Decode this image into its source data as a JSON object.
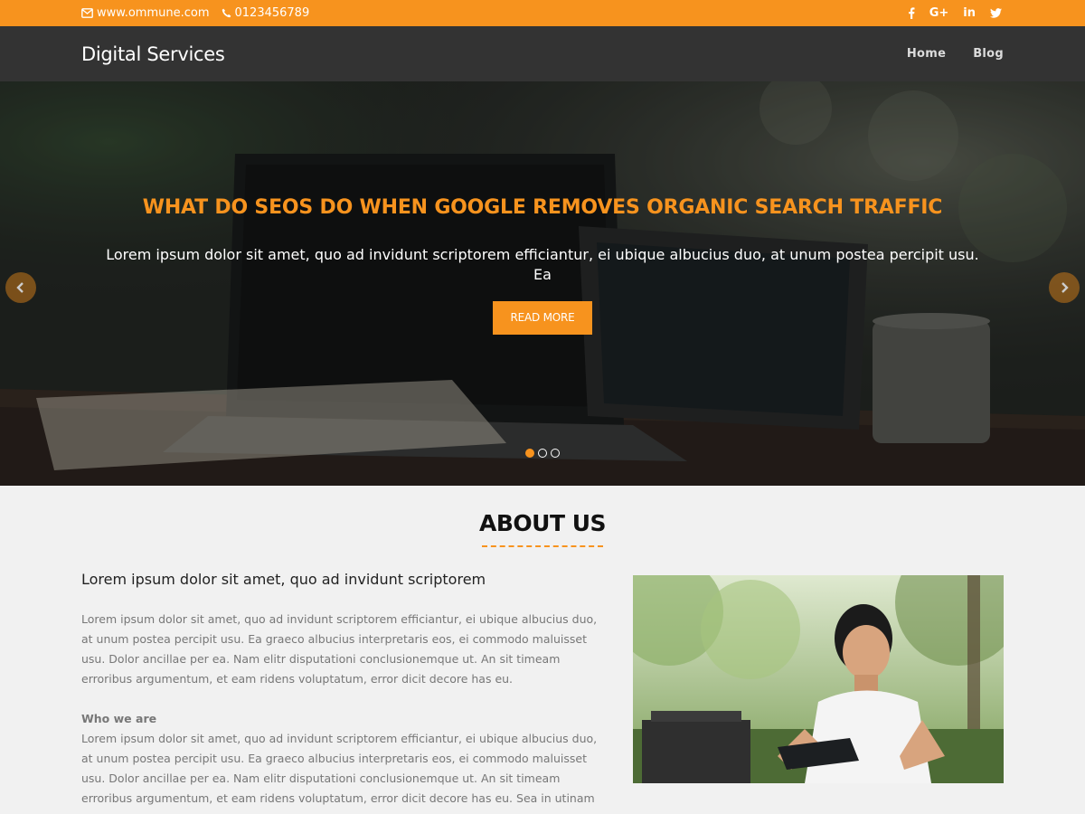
{
  "topbar": {
    "email": "www.ommune.com",
    "phone": "0123456789",
    "social": [
      {
        "icon": "facebook-icon",
        "glyph": "f"
      },
      {
        "icon": "google-plus-icon",
        "glyph": "G+"
      },
      {
        "icon": "linkedin-icon",
        "glyph": "in"
      },
      {
        "icon": "twitter-icon",
        "glyph": "twitter"
      }
    ]
  },
  "header": {
    "brand": "Digital Services",
    "nav": [
      {
        "label": "Home"
      },
      {
        "label": "Blog"
      }
    ]
  },
  "hero": {
    "title": "WHAT DO SEOS DO WHEN GOOGLE REMOVES ORGANIC SEARCH TRAFFIC",
    "text": "Lorem ipsum dolor sit amet, quo ad invidunt scriptorem efficiantur, ei ubique albucius duo, at unum postea percipit usu. Ea",
    "button": "READ MORE",
    "active_slide": 1,
    "slides_total": 3
  },
  "about": {
    "title": "ABOUT US",
    "heading": "Lorem ipsum dolor sit amet, quo ad invidunt scriptorem",
    "paragraph1": "Lorem ipsum dolor sit amet, quo ad invidunt scriptorem efficiantur, ei ubique albucius duo, at unum postea percipit usu. Ea graeco albucius interpretaris eos, ei commodo maluisset usu. Dolor ancillae per ea. Nam elitr disputationi conclusionemque ut. An sit timeam erroribus argumentum, et eam ridens voluptatum, error dicit decore has eu.",
    "subheading": "Who we are",
    "paragraph2": "Lorem ipsum dolor sit amet, quo ad invidunt scriptorem efficiantur, ei ubique albucius duo, at unum postea percipit usu. Ea graeco albucius interpretaris eos, ei commodo maluisset usu. Dolor ancillae per ea. Nam elitr disputationi conclusionemque ut. An sit timeam erroribus argumentum, et eam ridens voluptatum, error dicit decore has eu. Sea in utinam tempor"
  },
  "colors": {
    "accent": "#f7931e",
    "header_bg": "#333333",
    "page_bg": "#f1f1f1"
  }
}
